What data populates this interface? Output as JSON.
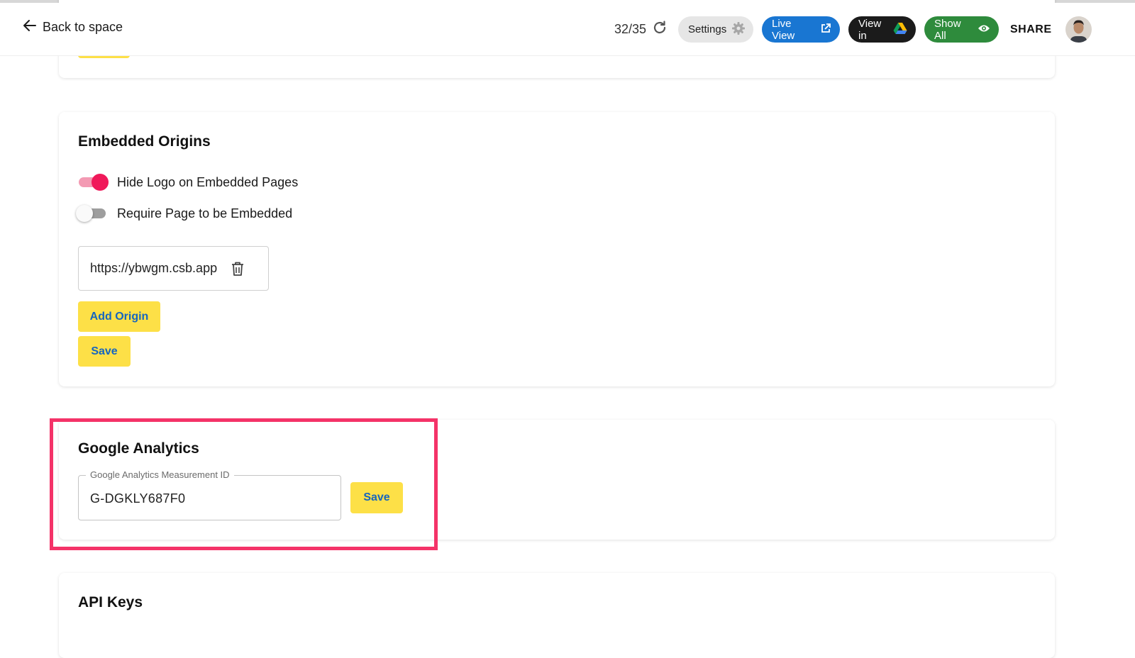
{
  "header": {
    "back_label": "Back to space",
    "counter": "32/35",
    "settings_label": "Settings",
    "live_view_label": "Live View",
    "view_in_label": "View in",
    "show_all_label": "Show All",
    "share_label": "SHARE"
  },
  "embedded_origins": {
    "title": "Embedded Origins",
    "toggles": [
      {
        "label": "Hide Logo on Embedded Pages",
        "on": true
      },
      {
        "label": "Require Page to be Embedded",
        "on": false
      }
    ],
    "origins": [
      "https://ybwgm.csb.app"
    ],
    "add_origin_label": "Add Origin",
    "save_label": "Save"
  },
  "google_analytics": {
    "title": "Google Analytics",
    "field_label": "Google Analytics Measurement ID",
    "field_value": "G-DGKLY687F0",
    "save_label": "Save"
  },
  "api_keys": {
    "title": "API Keys"
  },
  "colors": {
    "accent_yellow": "#fde047",
    "link_blue": "#1565c0",
    "toggle_on": "#f0195a",
    "highlight": "#f43368",
    "live_view_bg": "#1976d2",
    "show_all_bg": "#2e8b3c"
  }
}
